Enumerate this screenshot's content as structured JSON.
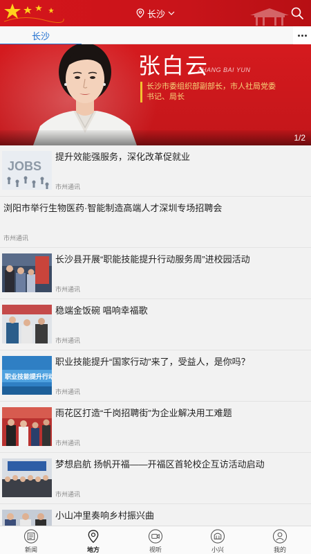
{
  "header": {
    "location": "长沙",
    "brand_color": "#d5151b"
  },
  "channels": {
    "active": "长沙",
    "accent": "#1f6fd0"
  },
  "banner": {
    "name": "张白云",
    "pinyin": "ZHANG BAI YUN",
    "title": "长沙市委组织部副部长，市人社局党委书记、局长",
    "page": "1/2"
  },
  "news": [
    {
      "title": "提升效能强服务，深化改革促就业",
      "source": "市州通讯",
      "thumb": "jobs"
    },
    {
      "title": "浏阳市举行生物医药·智能制造高端人才深圳专场招聘会",
      "source": "市州通讯",
      "thumb": ""
    },
    {
      "title": "长沙县开展“职能技能提升行动服务周”进校园活动",
      "source": "市州通讯",
      "thumb": "campus"
    },
    {
      "title": "稳端金饭碗 唱响幸福歌",
      "source": "市州通讯",
      "thumb": "people"
    },
    {
      "title": "职业技能提升“国家行动”来了，受益人，是你吗？",
      "source": "市州通讯",
      "thumb": "skills"
    },
    {
      "title": "雨花区打造“千岗招聘街”为企业解决用工难题",
      "source": "市州通讯",
      "thumb": "fair"
    },
    {
      "title": "梦想启航 扬帆开福——开福区首轮校企互访活动启动",
      "source": "市州通讯",
      "thumb": "meeting"
    },
    {
      "title": "小山冲里奏响乡村振兴曲",
      "source": "",
      "thumb": "village"
    }
  ],
  "thumb_text": {
    "jobs": "JOBS",
    "skills": "职业技能提升行动"
  },
  "nav": [
    {
      "label": "新闻",
      "icon": "newspaper-icon"
    },
    {
      "label": "地方",
      "icon": "location-pin-icon"
    },
    {
      "label": "视听",
      "icon": "video-icon"
    },
    {
      "label": "小兴",
      "icon": "building-icon"
    },
    {
      "label": "我的",
      "icon": "user-icon"
    }
  ]
}
